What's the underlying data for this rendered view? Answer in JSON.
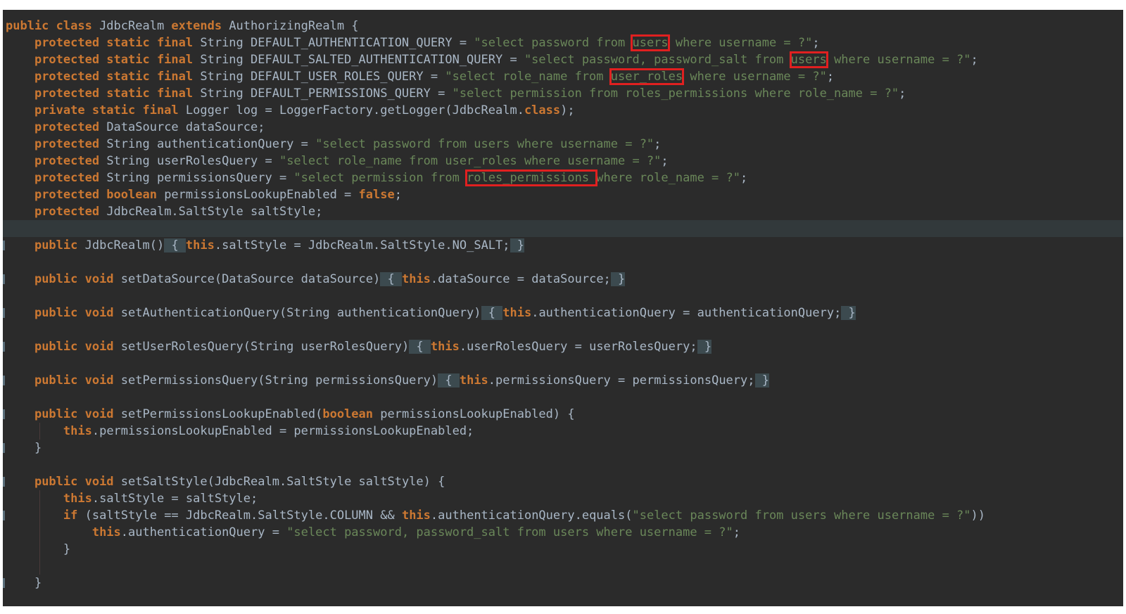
{
  "editor": {
    "language": "java",
    "background": "#2b2b2b",
    "highlight_color": "#e02020",
    "lines": [
      [
        {
          "t": "public class",
          "c": "kw"
        },
        {
          "t": " JdbcRealm "
        },
        {
          "t": "extends",
          "c": "kw"
        },
        {
          "t": " AuthorizingRealm {"
        }
      ],
      [
        {
          "t": "    "
        },
        {
          "t": "protected static final",
          "c": "kw"
        },
        {
          "t": " String DEFAULT_AUTHENTICATION_QUERY = "
        },
        {
          "t": "\"select password from ",
          "c": "str"
        },
        {
          "t": "users",
          "c": "str hl"
        },
        {
          "t": " where username = ?\"",
          "c": "str"
        },
        {
          "t": ";"
        }
      ],
      [
        {
          "t": "    "
        },
        {
          "t": "protected static final",
          "c": "kw"
        },
        {
          "t": " String DEFAULT_SALTED_AUTHENTICATION_QUERY = "
        },
        {
          "t": "\"select password, password_salt from ",
          "c": "str"
        },
        {
          "t": "users",
          "c": "str hl"
        },
        {
          "t": " where username = ?\"",
          "c": "str"
        },
        {
          "t": ";"
        }
      ],
      [
        {
          "t": "    "
        },
        {
          "t": "protected static final",
          "c": "kw"
        },
        {
          "t": " String DEFAULT_USER_ROLES_QUERY = "
        },
        {
          "t": "\"select role_name from ",
          "c": "str"
        },
        {
          "t": "user_roles",
          "c": "str hl"
        },
        {
          "t": " where username = ?\"",
          "c": "str"
        },
        {
          "t": ";"
        }
      ],
      [
        {
          "t": "    "
        },
        {
          "t": "protected static final",
          "c": "kw"
        },
        {
          "t": " String DEFAULT_PERMISSIONS_QUERY = "
        },
        {
          "t": "\"select permission from roles_permissions where role_name = ?\"",
          "c": "str"
        },
        {
          "t": ";"
        }
      ],
      [
        {
          "t": "    "
        },
        {
          "t": "private static final",
          "c": "kw"
        },
        {
          "t": " Logger log = LoggerFactory.getLogger(JdbcRealm."
        },
        {
          "t": "class",
          "c": "kw"
        },
        {
          "t": ");"
        }
      ],
      [
        {
          "t": "    "
        },
        {
          "t": "protected",
          "c": "kw"
        },
        {
          "t": " DataSource dataSource;"
        }
      ],
      [
        {
          "t": "    "
        },
        {
          "t": "protected",
          "c": "kw"
        },
        {
          "t": " String authenticationQuery = "
        },
        {
          "t": "\"select password from users where username = ?\"",
          "c": "str"
        },
        {
          "t": ";"
        }
      ],
      [
        {
          "t": "    "
        },
        {
          "t": "protected",
          "c": "kw"
        },
        {
          "t": " String userRolesQuery = "
        },
        {
          "t": "\"select role_name from user_roles where username = ?\"",
          "c": "str"
        },
        {
          "t": ";"
        }
      ],
      [
        {
          "t": "    "
        },
        {
          "t": "protected",
          "c": "kw"
        },
        {
          "t": " String permissionsQuery = "
        },
        {
          "t": "\"select permission from ",
          "c": "str"
        },
        {
          "t": "roles_permissions ",
          "c": "str hl"
        },
        {
          "t": "where role_name = ?\"",
          "c": "str"
        },
        {
          "t": ";"
        }
      ],
      [
        {
          "t": "    "
        },
        {
          "t": "protected boolean",
          "c": "kw"
        },
        {
          "t": " permissionsLookupEnabled = "
        },
        {
          "t": "false",
          "c": "kw"
        },
        {
          "t": ";"
        }
      ],
      [
        {
          "t": "    "
        },
        {
          "t": "protected",
          "c": "kw"
        },
        {
          "t": " JdbcRealm.SaltStyle saltStyle;"
        }
      ],
      [],
      [
        {
          "t": "    "
        },
        {
          "t": "public",
          "c": "kw"
        },
        {
          "t": " JdbcRealm()"
        },
        {
          "t": " { ",
          "c": "fold"
        },
        {
          "t": "this",
          "c": "kw"
        },
        {
          "t": ".saltStyle = JdbcRealm.SaltStyle.NO_SALT;"
        },
        {
          "t": " }",
          "c": "fold"
        }
      ],
      [],
      [
        {
          "t": "    "
        },
        {
          "t": "public void",
          "c": "kw"
        },
        {
          "t": " setDataSource(DataSource dataSource)"
        },
        {
          "t": " { ",
          "c": "fold"
        },
        {
          "t": "this",
          "c": "kw"
        },
        {
          "t": ".dataSource = dataSource;"
        },
        {
          "t": " }",
          "c": "fold"
        }
      ],
      [],
      [
        {
          "t": "    "
        },
        {
          "t": "public void",
          "c": "kw"
        },
        {
          "t": " setAuthenticationQuery(String authenticationQuery)"
        },
        {
          "t": " { ",
          "c": "fold"
        },
        {
          "t": "this",
          "c": "kw"
        },
        {
          "t": ".authenticationQuery = authenticationQuery;"
        },
        {
          "t": " }",
          "c": "fold"
        }
      ],
      [],
      [
        {
          "t": "    "
        },
        {
          "t": "public void",
          "c": "kw"
        },
        {
          "t": " setUserRolesQuery(String userRolesQuery)"
        },
        {
          "t": " { ",
          "c": "fold"
        },
        {
          "t": "this",
          "c": "kw"
        },
        {
          "t": ".userRolesQuery = userRolesQuery;"
        },
        {
          "t": " }",
          "c": "fold"
        }
      ],
      [],
      [
        {
          "t": "    "
        },
        {
          "t": "public void",
          "c": "kw"
        },
        {
          "t": " setPermissionsQuery(String permissionsQuery)"
        },
        {
          "t": " { ",
          "c": "fold"
        },
        {
          "t": "this",
          "c": "kw"
        },
        {
          "t": ".permissionsQuery = permissionsQuery;"
        },
        {
          "t": " }",
          "c": "fold"
        }
      ],
      [],
      [
        {
          "t": "    "
        },
        {
          "t": "public void",
          "c": "kw"
        },
        {
          "t": " setPermissionsLookupEnabled("
        },
        {
          "t": "boolean",
          "c": "kw"
        },
        {
          "t": " permissionsLookupEnabled) {"
        }
      ],
      [
        {
          "t": "        "
        },
        {
          "t": "this",
          "c": "kw"
        },
        {
          "t": ".permissionsLookupEnabled = permissionsLookupEnabled;"
        }
      ],
      [
        {
          "t": "    }"
        }
      ],
      [],
      [
        {
          "t": "    "
        },
        {
          "t": "public void",
          "c": "kw"
        },
        {
          "t": " setSaltStyle(JdbcRealm.SaltStyle saltStyle) {"
        }
      ],
      [
        {
          "t": "        "
        },
        {
          "t": "this",
          "c": "kw"
        },
        {
          "t": ".saltStyle = saltStyle;"
        }
      ],
      [
        {
          "t": "        "
        },
        {
          "t": "if",
          "c": "kw"
        },
        {
          "t": " (saltStyle == JdbcRealm.SaltStyle.COLUMN && "
        },
        {
          "t": "this",
          "c": "kw"
        },
        {
          "t": ".authenticationQuery.equals("
        },
        {
          "t": "\"select password from users where username = ?\"",
          "c": "str"
        },
        {
          "t": "))"
        }
      ],
      [
        {
          "t": "            "
        },
        {
          "t": "this",
          "c": "kw"
        },
        {
          "t": ".authenticationQuery = "
        },
        {
          "t": "\"select password, password_salt from users where username = ?\"",
          "c": "str"
        },
        {
          "t": ";"
        }
      ],
      [
        {
          "t": "        }"
        }
      ],
      [],
      [
        {
          "t": "    }"
        }
      ]
    ]
  }
}
